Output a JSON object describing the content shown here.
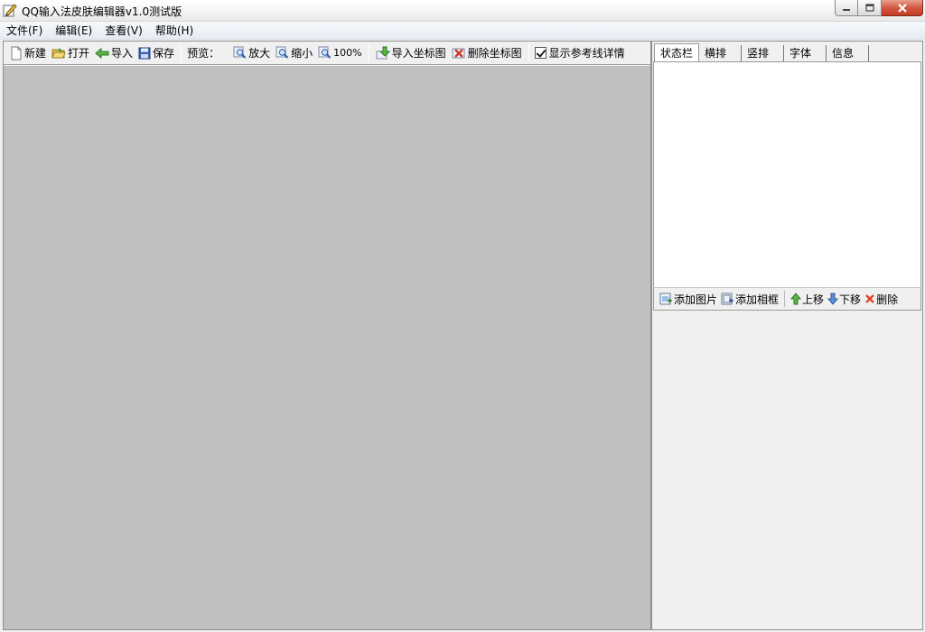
{
  "window": {
    "title": "QQ输入法皮肤编辑器v1.0测试版"
  },
  "menu": [
    {
      "label": "文件(F)"
    },
    {
      "label": "编辑(E)"
    },
    {
      "label": "查看(V)"
    },
    {
      "label": "帮助(H)"
    }
  ],
  "toolbar": {
    "new_label": "新建",
    "open_label": "打开",
    "import_label": "导入",
    "save_label": "保存",
    "preview_label": "预览：",
    "zoom_in_label": "放大",
    "zoom_out_label": "缩小",
    "zoom_100_label": "100%",
    "import_coord_label": "导入坐标图",
    "delete_coord_label": "删除坐标图",
    "show_guides_label": "显示参考线详情",
    "show_guides_checked": true
  },
  "right_panel": {
    "tabs": [
      {
        "label": "状态栏",
        "active": true
      },
      {
        "label": "横排",
        "active": false
      },
      {
        "label": "竖排",
        "active": false
      },
      {
        "label": "字体",
        "active": false
      },
      {
        "label": "信息",
        "active": false
      }
    ],
    "list_toolbar": {
      "add_image_label": "添加图片",
      "add_frame_label": "添加相框",
      "move_up_label": "上移",
      "move_down_label": "下移",
      "delete_label": "删除"
    }
  },
  "colors": {
    "canvas": "#c0c0c0",
    "window_bg": "#f0f0f0",
    "close_button": "#c53a22"
  }
}
